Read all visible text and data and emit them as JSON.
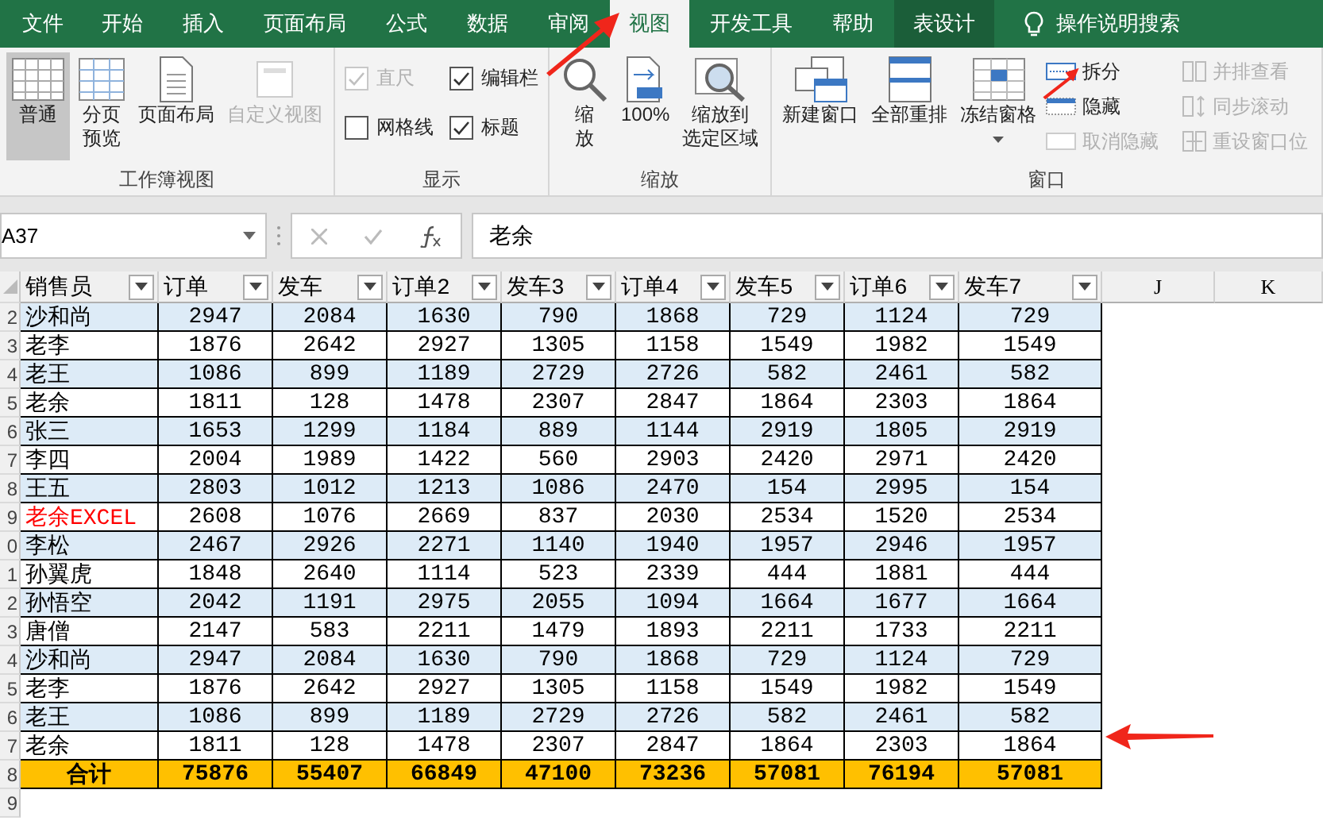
{
  "tabs": [
    {
      "label": "文件",
      "selected": false,
      "kind": "tab"
    },
    {
      "label": "开始",
      "selected": false,
      "kind": "tab"
    },
    {
      "label": "插入",
      "selected": false,
      "kind": "tab"
    },
    {
      "label": "页面布局",
      "selected": false,
      "kind": "tab"
    },
    {
      "label": "公式",
      "selected": false,
      "kind": "tab"
    },
    {
      "label": "数据",
      "selected": false,
      "kind": "tab"
    },
    {
      "label": "审阅",
      "selected": false,
      "kind": "tab"
    },
    {
      "label": "视图",
      "selected": true,
      "kind": "tab"
    },
    {
      "label": "开发工具",
      "selected": false,
      "kind": "tab"
    },
    {
      "label": "帮助",
      "selected": false,
      "kind": "tab"
    },
    {
      "label": "表设计",
      "selected": false,
      "kind": "contextual"
    }
  ],
  "search": {
    "label": "操作说明搜索"
  },
  "ribbon": {
    "groups": [
      {
        "title": "工作簿视图",
        "items": [
          {
            "kind": "large",
            "label": "普通",
            "selected": true,
            "disabled": false
          },
          {
            "kind": "large",
            "lines": [
              "分页",
              "预览"
            ],
            "selected": false,
            "disabled": false
          },
          {
            "kind": "large",
            "label": "页面布局",
            "selected": false,
            "disabled": false
          },
          {
            "kind": "large",
            "label": "自定义视图",
            "selected": false,
            "disabled": true
          }
        ]
      },
      {
        "title": "显示",
        "items": [
          {
            "kind": "check",
            "label": "直尺",
            "checked": true,
            "disabled": true
          },
          {
            "kind": "check",
            "label": "编辑栏",
            "checked": true,
            "disabled": false
          },
          {
            "kind": "check",
            "label": "网格线",
            "checked": false,
            "disabled": false
          },
          {
            "kind": "check",
            "label": "标题",
            "checked": true,
            "disabled": false
          }
        ]
      },
      {
        "title": "缩放",
        "items": [
          {
            "kind": "large",
            "lines": [
              "缩",
              "放"
            ],
            "disabled": false
          },
          {
            "kind": "large",
            "label": "100%",
            "disabled": false
          },
          {
            "kind": "large",
            "lines": [
              "缩放到",
              "选定区域"
            ],
            "disabled": false
          }
        ]
      },
      {
        "title": "窗口",
        "items": [
          {
            "kind": "large",
            "label": "新建窗口",
            "disabled": false
          },
          {
            "kind": "large",
            "label": "全部重排",
            "disabled": false
          },
          {
            "kind": "large",
            "label": "冻结窗格",
            "disabled": false,
            "menu": true
          },
          {
            "kind": "small",
            "label": "拆分",
            "disabled": false
          },
          {
            "kind": "small",
            "label": "隐藏",
            "disabled": false
          },
          {
            "kind": "small",
            "label": "取消隐藏",
            "disabled": true
          },
          {
            "kind": "small",
            "label": "并排查看",
            "disabled": true
          },
          {
            "kind": "small",
            "label": "同步滚动",
            "disabled": true
          },
          {
            "kind": "small",
            "label": "重设窗口位",
            "disabled": true
          }
        ]
      }
    ]
  },
  "formula_bar": {
    "name_box": "A37",
    "value": "老余"
  },
  "sheet": {
    "columns": [
      "销售员",
      "订单",
      "发车",
      "订单2",
      "发车3",
      "订单4",
      "发车5",
      "订单6",
      "发车7"
    ],
    "column_letters": [
      "J",
      "K"
    ],
    "rows": [
      {
        "row_header": "2",
        "color": "#000000",
        "cells": [
          "沙和尚",
          "2947",
          "2084",
          "1630",
          "790",
          "1868",
          "729",
          "1124",
          "729"
        ]
      },
      {
        "row_header": "3",
        "color": "#000000",
        "cells": [
          "老李",
          "1876",
          "2642",
          "2927",
          "1305",
          "1158",
          "1549",
          "1982",
          "1549"
        ]
      },
      {
        "row_header": "4",
        "color": "#000000",
        "cells": [
          "老王",
          "1086",
          "899",
          "1189",
          "2729",
          "2726",
          "582",
          "2461",
          "582"
        ]
      },
      {
        "row_header": "5",
        "color": "#000000",
        "cells": [
          "老余",
          "1811",
          "128",
          "1478",
          "2307",
          "2847",
          "1864",
          "2303",
          "1864"
        ]
      },
      {
        "row_header": "6",
        "color": "#000000",
        "cells": [
          "张三",
          "1653",
          "1299",
          "1184",
          "889",
          "1144",
          "2919",
          "1805",
          "2919"
        ]
      },
      {
        "row_header": "7",
        "color": "#000000",
        "cells": [
          "李四",
          "2004",
          "1989",
          "1422",
          "560",
          "2903",
          "2420",
          "2971",
          "2420"
        ]
      },
      {
        "row_header": "8",
        "color": "#000000",
        "cells": [
          "王五",
          "2803",
          "1012",
          "1213",
          "1086",
          "2470",
          "154",
          "2995",
          "154"
        ]
      },
      {
        "row_header": "9",
        "color": "#ff0000",
        "cells": [
          "老余EXCEL",
          "2608",
          "1076",
          "2669",
          "837",
          "2030",
          "2534",
          "1520",
          "2534"
        ]
      },
      {
        "row_header": "0",
        "color": "#000000",
        "cells": [
          "李松",
          "2467",
          "2926",
          "2271",
          "1140",
          "1940",
          "1957",
          "2946",
          "1957"
        ]
      },
      {
        "row_header": "1",
        "color": "#000000",
        "cells": [
          "孙翼虎",
          "1848",
          "2640",
          "1114",
          "523",
          "2339",
          "444",
          "1881",
          "444"
        ]
      },
      {
        "row_header": "2",
        "color": "#000000",
        "cells": [
          "孙悟空",
          "2042",
          "1191",
          "2975",
          "2055",
          "1094",
          "1664",
          "1677",
          "1664"
        ]
      },
      {
        "row_header": "3",
        "color": "#000000",
        "cells": [
          "唐僧",
          "2147",
          "583",
          "2211",
          "1479",
          "1893",
          "2211",
          "1733",
          "2211"
        ]
      },
      {
        "row_header": "4",
        "color": "#000000",
        "cells": [
          "沙和尚",
          "2947",
          "2084",
          "1630",
          "790",
          "1868",
          "729",
          "1124",
          "729"
        ]
      },
      {
        "row_header": "5",
        "color": "#000000",
        "cells": [
          "老李",
          "1876",
          "2642",
          "2927",
          "1305",
          "1158",
          "1549",
          "1982",
          "1549"
        ]
      },
      {
        "row_header": "6",
        "color": "#000000",
        "cells": [
          "老王",
          "1086",
          "899",
          "1189",
          "2729",
          "2726",
          "582",
          "2461",
          "582"
        ]
      },
      {
        "row_header": "7",
        "color": "#000000",
        "cells": [
          "老余",
          "1811",
          "128",
          "1478",
          "2307",
          "2847",
          "1864",
          "2303",
          "1864"
        ]
      }
    ],
    "total": {
      "row_header": "8",
      "cells": [
        "合计",
        "75876",
        "55407",
        "66849",
        "47100",
        "73236",
        "57081",
        "76194",
        "57081"
      ]
    },
    "empty_rows": [
      "9"
    ]
  }
}
